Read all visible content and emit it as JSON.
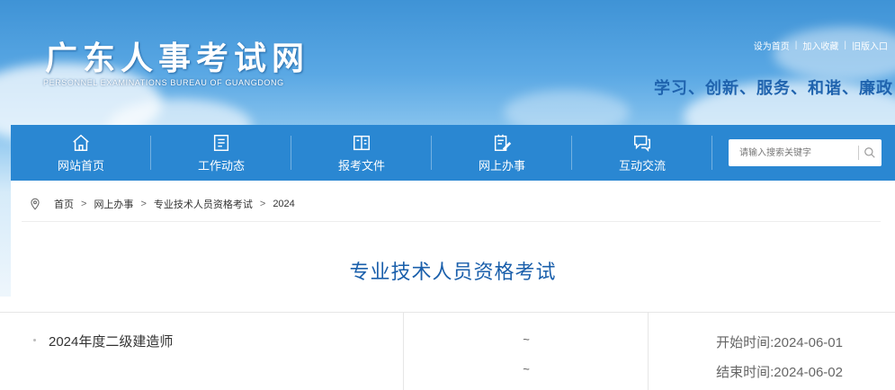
{
  "header": {
    "logo_cn": "广东人事考试网",
    "logo_en": "PERSONNEL EXAMINATIONS BUREAU OF GUANGDONG",
    "top_links": [
      "设为首页",
      "加入收藏",
      "旧版入口"
    ],
    "slogan": "学习、创新、服务、和谐、廉政"
  },
  "nav": {
    "items": [
      {
        "label": "网站首页",
        "icon": "home-icon"
      },
      {
        "label": "工作动态",
        "icon": "news-icon"
      },
      {
        "label": "报考文件",
        "icon": "book-icon"
      },
      {
        "label": "网上办事",
        "icon": "edit-doc-icon"
      },
      {
        "label": "互动交流",
        "icon": "chat-icon"
      }
    ],
    "search": {
      "placeholder": "请输入搜索关键字",
      "icon": "search-icon"
    }
  },
  "breadcrumb": {
    "icon": "location-pin-icon",
    "items": [
      "首页",
      "网上办事",
      "专业技术人员资格考试",
      "2024"
    ],
    "separator": ">"
  },
  "page_title": "专业技术人员资格考试",
  "exam_list": [
    {
      "name": "2024年度二级建造师",
      "mid_1": "~",
      "mid_2": "~",
      "start": "开始时间:2024-06-01",
      "end": "结束时间:2024-06-02"
    }
  ],
  "colors": {
    "nav_bg": "#2a87d2",
    "title": "#1a5fab",
    "slogan": "#1f63ae"
  }
}
